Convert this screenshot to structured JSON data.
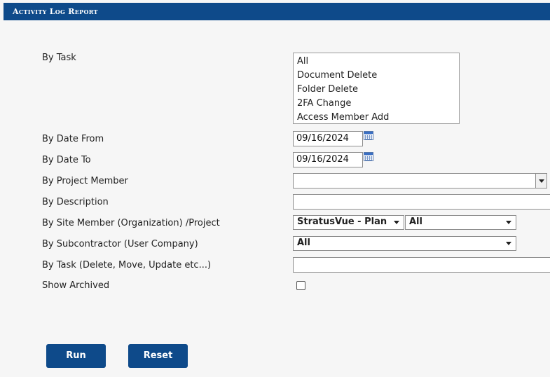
{
  "header": {
    "title": "Activity Log Report"
  },
  "form": {
    "by_task": {
      "label": "By Task",
      "options": [
        "All",
        "Document Delete",
        "Folder Delete",
        "2FA Change",
        "Access Member Add"
      ]
    },
    "date_from": {
      "label": "By Date From",
      "value": "09/16/2024",
      "icon": "calendar-icon"
    },
    "date_to": {
      "label": "By Date To",
      "value": "09/16/2024",
      "icon": "calendar-icon"
    },
    "project_member": {
      "label": "By Project Member",
      "value": ""
    },
    "description": {
      "label": "By Description",
      "value": ""
    },
    "site_member": {
      "label": "By Site Member (Organization) /Project",
      "organization_value": "StratusVue - Plans and Specs",
      "project_value": "All"
    },
    "subcontractor": {
      "label": "By Subcontractor (User Company)",
      "value": "All"
    },
    "task_text": {
      "label": "By Task (Delete, Move, Update etc...)",
      "value": ""
    },
    "show_archived": {
      "label": "Show Archived",
      "checked": false
    }
  },
  "buttons": {
    "run": "Run",
    "reset": "Reset"
  },
  "colors": {
    "header_bg": "#0e4a8a",
    "button_bg": "#0e4a8a",
    "page_bg": "#f6f6f6"
  }
}
